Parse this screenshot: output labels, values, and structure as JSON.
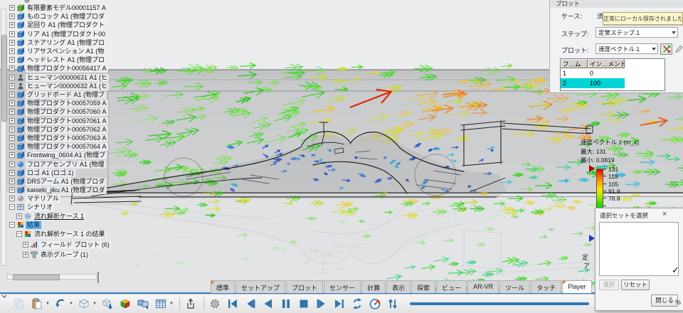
{
  "tree": {
    "items": [
      {
        "partial": true,
        "icon": "material"
      },
      {
        "label": "有限要素モデル00001157 A",
        "level": 0,
        "icon": "fem",
        "exp": "+"
      },
      {
        "label": "ものコック A1 (物理プロダ",
        "level": 0,
        "icon": "product",
        "exp": "+"
      },
      {
        "label": "足回り A1 (物理プロダクト",
        "level": 0,
        "icon": "product",
        "exp": "+"
      },
      {
        "label": "リア A1 (物理プロダクト00",
        "level": 0,
        "icon": "product",
        "exp": "+"
      },
      {
        "label": "ステアリング A1 (物理プロ",
        "level": 0,
        "icon": "product",
        "exp": "+"
      },
      {
        "label": "リアサスペンション A1 (物",
        "level": 0,
        "icon": "product",
        "exp": "+"
      },
      {
        "label": "ヘッドレスト A1 (物理プロ",
        "level": 0,
        "icon": "product",
        "exp": "+"
      },
      {
        "label": "物理プロダクト00056417 A",
        "level": 0,
        "icon": "product",
        "exp": "+"
      },
      {
        "label": "ヒューマン00000631 A1 (ヒ",
        "level": 0,
        "icon": "human",
        "exp": "+"
      },
      {
        "label": "ヒューマン00000632 A1 (ヒ",
        "level": 0,
        "icon": "human",
        "exp": "+"
      },
      {
        "label": "グリッドボード A1 (物理プ",
        "level": 0,
        "icon": "product",
        "exp": "+"
      },
      {
        "label": "物理プロダクト00057059 A",
        "level": 0,
        "icon": "product",
        "exp": "+"
      },
      {
        "label": "物理プロダクト00057060 A",
        "level": 0,
        "icon": "product",
        "exp": "+"
      },
      {
        "label": "物理プロダクト00057061 A",
        "level": 0,
        "icon": "product",
        "exp": "+"
      },
      {
        "label": "物理プロダクト00057062 A",
        "level": 0,
        "icon": "product",
        "exp": "+"
      },
      {
        "label": "物理プロダクト00057063 A",
        "level": 0,
        "icon": "product",
        "exp": "+"
      },
      {
        "label": "物理プロダクト00057064 A",
        "level": 0,
        "icon": "product",
        "exp": "+"
      },
      {
        "label": "Frontwing_0604 A1 (物理プ",
        "level": 0,
        "icon": "product",
        "exp": "+"
      },
      {
        "label": "フロアアセンブリ A1 (物理",
        "level": 0,
        "icon": "sphere",
        "exp": "+"
      },
      {
        "label": "ロゴ A1 (ロゴ.1)",
        "level": 0,
        "icon": "product",
        "exp": "+"
      },
      {
        "label": "DRSアーム A1 (物理プロダ",
        "level": 0,
        "icon": "product",
        "exp": "+"
      },
      {
        "label": "kaiseki_jiku A1 (物理プロダ",
        "level": 0,
        "icon": "product",
        "exp": "+"
      },
      {
        "label": "マテリアル",
        "level": 0,
        "icon": "material",
        "exp": "+"
      },
      {
        "label": "シナリオ",
        "level": 0,
        "icon": "scenario",
        "exp": "-",
        "gap": 1
      },
      {
        "label": "流れ解析ケース 1",
        "level": 1,
        "icon": "case",
        "exp": "+",
        "underline": true
      },
      {
        "label": "結果",
        "level": 0,
        "icon": "results",
        "exp": "-",
        "selected": true
      },
      {
        "label": "流れ解析ケース 1 の結果",
        "level": 1,
        "icon": "results",
        "exp": "-"
      },
      {
        "label": "フィールド プロット (6)",
        "level": 2,
        "icon": "fieldplot",
        "exp": "+"
      },
      {
        "label": "表示グループ (1)",
        "level": 2,
        "icon": "dispgroup",
        "exp": "+"
      }
    ]
  },
  "plot_panel": {
    "header": "プロット",
    "case_label": "ケース:",
    "case_value": "流れ",
    "step_label": "ステップ:",
    "step_value": "定常ステップ.1",
    "plot_label": "プロット:",
    "plot_value": "速度ベクトル.1",
    "toast": "正常にローカル保存されました。",
    "table": {
      "headers": [
        "フ…ム",
        "イン…メント"
      ],
      "rows": [
        [
          "1",
          "0"
        ],
        [
          "2",
          "100"
        ]
      ],
      "selected_row": 1,
      "highlight_color": "#00d4d4"
    }
  },
  "legend": {
    "title": "速度ベクトル.1 (m_s)",
    "max_label": "最大: 131",
    "min_label": "最小: 0.0819",
    "ticks": [
      "131",
      "118",
      "105",
      "91.9",
      "78.8"
    ],
    "max_value": 131,
    "min_value": 0.0819,
    "colorbar_top_color": "#d40000",
    "colorbar_bottom_color": "#1800a8"
  },
  "viewport_fragments": {
    "frag_a": "定",
    "frag_b": "ア",
    "check": "✓"
  },
  "dialog": {
    "title": "選択セットを選択",
    "help": "?",
    "close_x": "×",
    "select_btn": "選択",
    "reset_btn": "リセット",
    "close_btn": "閉じる"
  },
  "ribbon": {
    "tabs": [
      {
        "label": "標準",
        "flag": true
      },
      {
        "label": "セットアップ"
      },
      {
        "label": "プロット"
      },
      {
        "label": "センサー"
      },
      {
        "label": "計算"
      },
      {
        "label": "表示"
      },
      {
        "label": "探索"
      },
      {
        "label": "ビュー"
      },
      {
        "label": "AR-VR"
      },
      {
        "label": "ツール"
      },
      {
        "label": "タッチ"
      },
      {
        "label": "Player",
        "flag": true,
        "active": true
      }
    ]
  },
  "toolbar": {
    "items": [
      {
        "icon": "copy",
        "grayed": true
      },
      {
        "icon": "paste",
        "dropdown": true
      },
      {
        "icon": "undo",
        "dropdown": true
      },
      {
        "icon": "part-box",
        "dropdown": true
      },
      {
        "icon": "part-import"
      },
      {
        "icon": "colored-cube"
      },
      {
        "icon": "frames"
      },
      {
        "icon": "table-view",
        "dropdown": true
      },
      {
        "sep": true
      },
      {
        "icon": "export"
      },
      {
        "sep": true
      },
      {
        "icon": "gear"
      },
      {
        "icon": "skip-start"
      },
      {
        "icon": "step-back"
      },
      {
        "icon": "play-reverse"
      },
      {
        "icon": "pause"
      },
      {
        "icon": "stop"
      },
      {
        "icon": "step-forward"
      },
      {
        "icon": "skip-end"
      },
      {
        "icon": "loop"
      },
      {
        "icon": "speed"
      },
      {
        "icon": "swap-vertical"
      }
    ],
    "percent_label": "%"
  }
}
